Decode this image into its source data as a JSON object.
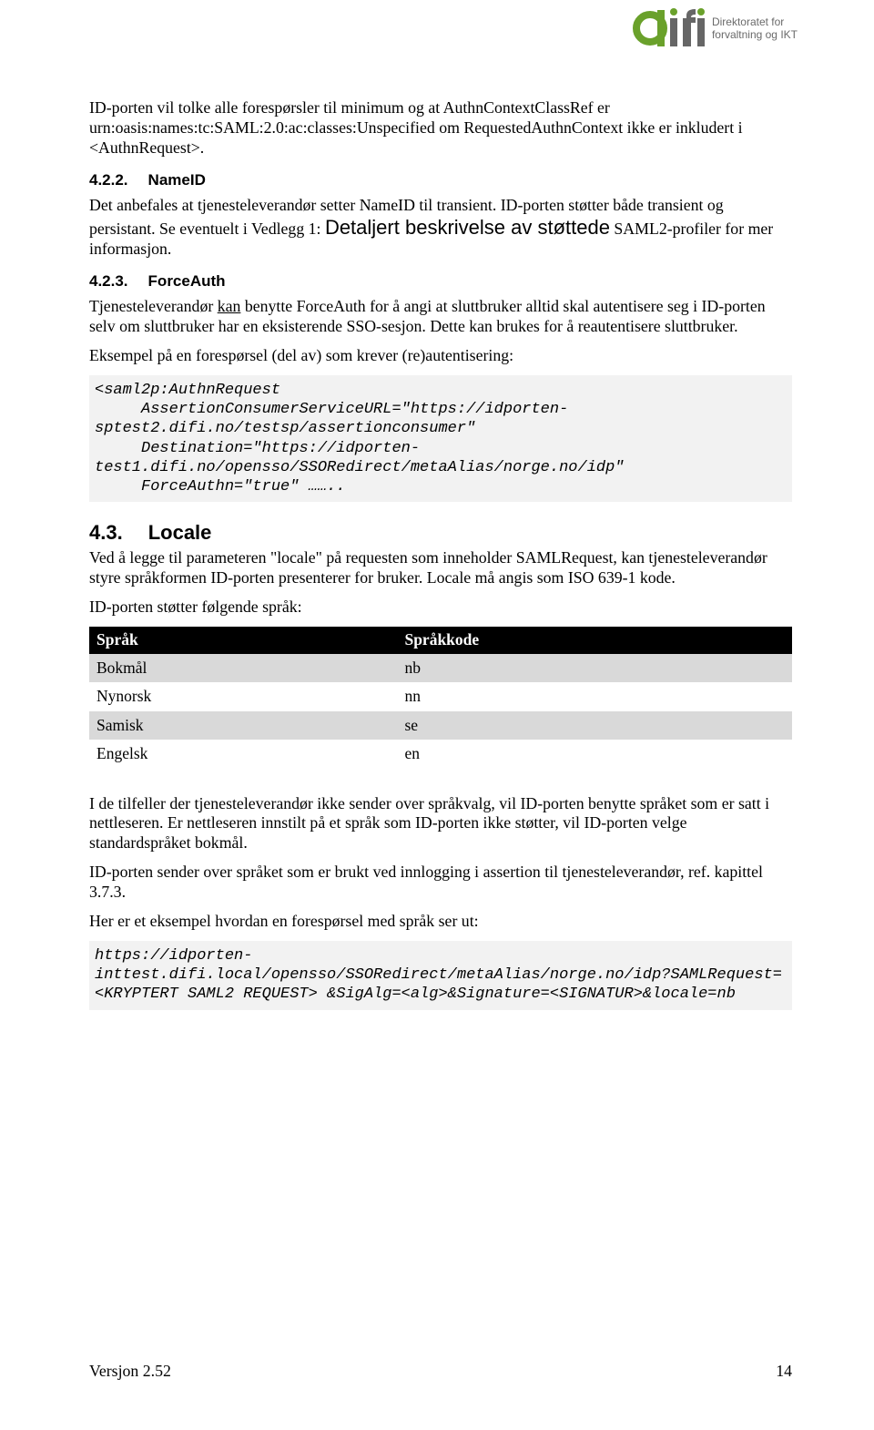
{
  "logo": {
    "line1": "Direktoratet for",
    "line2": "forvaltning og IKT"
  },
  "p1a": "ID-porten vil tolke alle forespørsler til minimum og at AuthnContextClassRef er",
  "p1b": "urn:oasis:names:tc:SAML:2.0:ac:classes:Unspecified om RequestedAuthnContext ikke er inkludert i <AuthnRequest>.",
  "s422": {
    "num": "4.2.2.",
    "title": "NameID"
  },
  "p422a": "Det anbefales at tjenesteleverandør setter NameID til transient. ID-porten støtter både transient og",
  "p422b_pre": "persistant. Se eventuelt i Vedlegg 1: ",
  "p422b_link": "Detaljert beskrivelse av støttede",
  "p422b_post": " SAML2-profiler for mer informasjon.",
  "s423": {
    "num": "4.2.3.",
    "title": "ForceAuth"
  },
  "p423a_pre": "Tjenesteleverandør ",
  "p423a_kan": "kan",
  "p423a_post": " benytte ForceAuth for å angi at sluttbruker alltid skal autentisere seg i ID-porten selv om sluttbruker har en eksisterende SSO-sesjon. Dette kan brukes for å reautentisere sluttbruker.",
  "p423b": "Eksempel på en forespørsel (del av) som krever (re)autentisering:",
  "code1": "<saml2p:AuthnRequest\n     AssertionConsumerServiceURL=\"https://idporten-sptest2.difi.no/testsp/assertionconsumer\"\n     Destination=\"https://idporten-test1.difi.no/opensso/SSORedirect/metaAlias/norge.no/idp\"\n     ForceAuthn=\"true\" ……..",
  "s43": {
    "num": "4.3.",
    "title": "Locale"
  },
  "p43a": "Ved å legge til parameteren \"locale\" på requesten som inneholder SAMLRequest, kan tjenesteleverandør styre språkformen ID-porten presenterer for bruker. Locale må angis som ISO 639-1 kode.",
  "p43b": "ID-porten støtter følgende språk:",
  "table": {
    "headers": [
      "Språk",
      "Språkkode"
    ],
    "rows": [
      {
        "lang": "Bokmål",
        "code": "nb",
        "shade": true
      },
      {
        "lang": "Nynorsk",
        "code": "nn",
        "shade": false
      },
      {
        "lang": "Samisk",
        "code": "se",
        "shade": true
      },
      {
        "lang": "Engelsk",
        "code": "en",
        "shade": false
      }
    ]
  },
  "p43c": "I de tilfeller der tjenesteleverandør ikke sender over språkvalg, vil ID-porten benytte språket som er satt i nettleseren. Er nettleseren innstilt på et språk som ID-porten ikke støtter, vil ID-porten velge standardspråket bokmål.",
  "p43d": "ID-porten sender over språket som er brukt ved innlogging i assertion til tjenesteleverandør, ref. kapittel 3.7.3.",
  "p43e": "Her er et eksempel hvordan en forespørsel med språk ser ut:",
  "code2": "https://idporten-inttest.difi.local/opensso/SSORedirect/metaAlias/norge.no/idp?SAMLRequest=<KRYPTERT SAML2 REQUEST> &SigAlg=<alg>&Signature=<SIGNATUR>&locale=nb",
  "footer": {
    "left": "Versjon 2.52",
    "right": "14"
  }
}
